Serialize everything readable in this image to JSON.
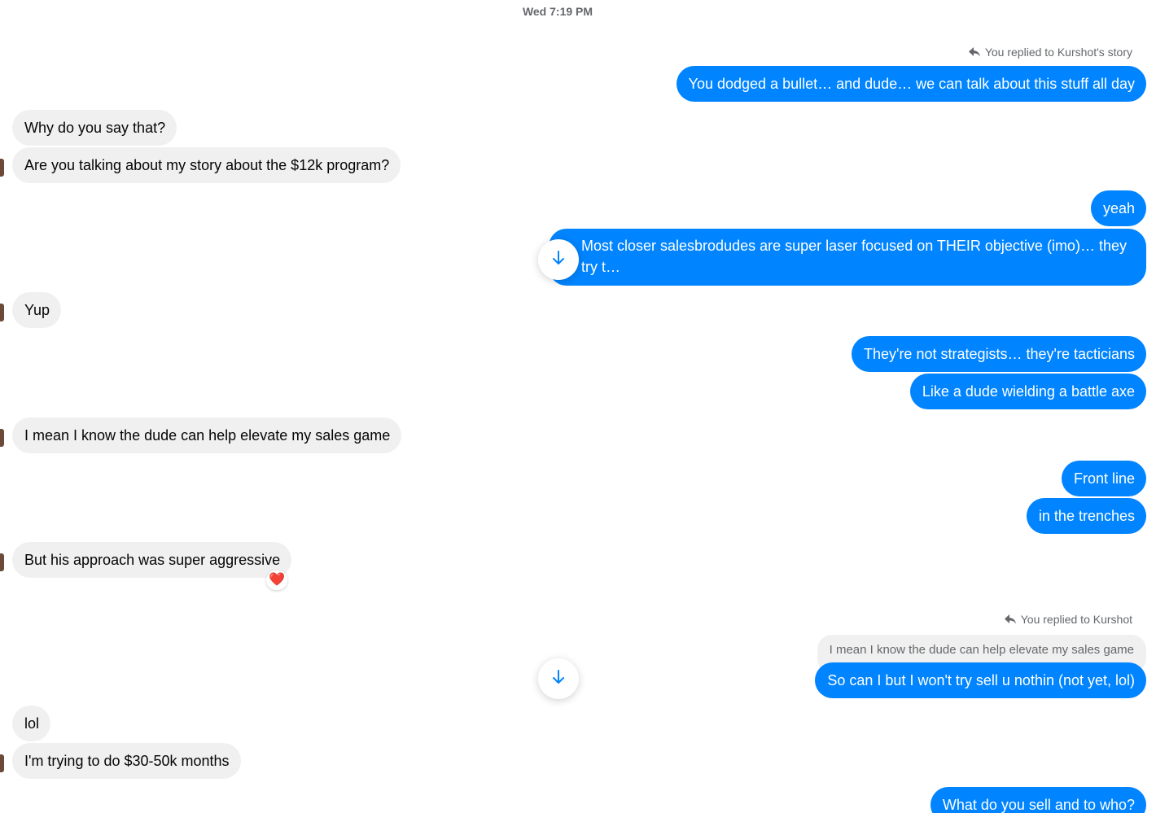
{
  "conversation": {
    "timestamp": "Wed 7:19 PM",
    "story_reply_label": "You replied to Kurshot's story",
    "reply_label": "You replied to Kurshot",
    "quoted_message": "I mean I know the dude can help elevate my sales game",
    "reaction": "❤️",
    "messages": [
      {
        "sender": "me",
        "text": "You dodged a bullet… and dude… we can talk about this stuff all day"
      },
      {
        "sender": "them",
        "text": "Why do you say that?"
      },
      {
        "sender": "them",
        "text": "Are you talking about my story about the $12k program?"
      },
      {
        "sender": "me",
        "text": "yeah"
      },
      {
        "sender": "me",
        "text": "Most closer salesbrodudes are super laser focused on THEIR objective (imo)… they try t…"
      },
      {
        "sender": "them",
        "text": "Yup"
      },
      {
        "sender": "me",
        "text": "They're not strategists… they're tacticians"
      },
      {
        "sender": "me",
        "text": "Like a dude wielding a battle axe"
      },
      {
        "sender": "them",
        "text": "I mean I know the dude can help elevate my sales game"
      },
      {
        "sender": "me",
        "text": "Front line"
      },
      {
        "sender": "me",
        "text": "in the trenches"
      },
      {
        "sender": "them",
        "text": "But his approach was super aggressive"
      },
      {
        "sender": "me",
        "text": "So can I but I won't try sell u nothin (not yet, lol)"
      },
      {
        "sender": "them",
        "text": "lol"
      },
      {
        "sender": "them",
        "text": "I'm trying to do $30-50k months"
      },
      {
        "sender": "me",
        "text": "What do you sell and to who?"
      }
    ]
  },
  "colors": {
    "outgoing_bubble": "#0084ff",
    "incoming_bubble": "#f0f0f0",
    "meta_text": "#65676b",
    "avatar": "#6b4a3a"
  },
  "icons": {
    "reply": "reply-arrow-icon",
    "scroll_down": "arrow-down-icon",
    "reaction": "heart-icon"
  }
}
